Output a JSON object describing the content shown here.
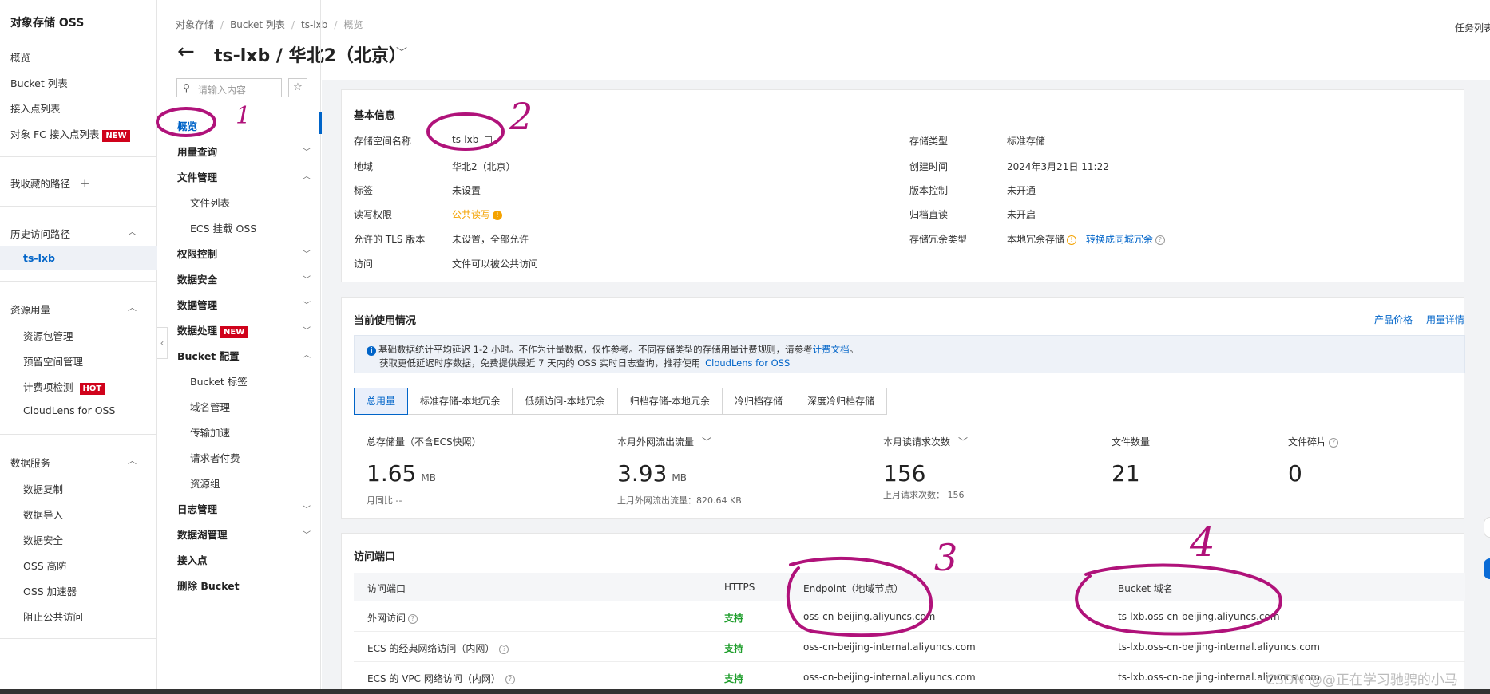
{
  "sidebar": {
    "title": "对象存储 OSS",
    "items": [
      "概览",
      "Bucket 列表",
      "接入点列表",
      "对象 FC 接入点列表"
    ],
    "fc_badge": "NEW",
    "favorites": "我收藏的路径",
    "favorites_add": "+",
    "history_group": "历史访问路径",
    "history_item": "ts-lxb",
    "resource_group": "资源用量",
    "resource_items": [
      "资源包管理",
      "预留空间管理",
      "计费项检测",
      "CloudLens for OSS"
    ],
    "hot_badge": "HOT",
    "data_group": "数据服务",
    "data_items": [
      "数据复制",
      "数据导入",
      "数据安全",
      "OSS 高防",
      "OSS 加速器",
      "阻止公共访问"
    ]
  },
  "header": {
    "breadcrumb": [
      "对象存储",
      "Bucket 列表",
      "ts-lxb",
      "概览"
    ],
    "title": "ts-lxb / 华北2（北京）",
    "task_list": "任务列表"
  },
  "subnav": {
    "search_placeholder": "请输入内容",
    "active": "概览",
    "items": {
      "usage": "用量查询",
      "file_mgmt": "文件管理",
      "file_list": "文件列表",
      "ecs_mount": "ECS 挂载 OSS",
      "perm": "权限控制",
      "data_security": "数据安全",
      "data_mgmt": "数据管理",
      "data_proc": "数据处理",
      "data_proc_badge": "NEW",
      "bucket_config": "Bucket 配置",
      "bucket_tag": "Bucket 标签",
      "domain": "域名管理",
      "transfer": "传输加速",
      "requester_pays": "请求者付费",
      "resource_group": "资源组",
      "log_mgmt": "日志管理",
      "datalake": "数据湖管理",
      "access_point": "接入点",
      "delete_bucket": "删除 Bucket"
    }
  },
  "basic_info": {
    "title": "基本信息",
    "left": [
      {
        "label": "存储空间名称",
        "value": "ts-lxb"
      },
      {
        "label": "地域",
        "value": "华北2（北京）"
      },
      {
        "label": "标签",
        "value": "未设置"
      },
      {
        "label": "读写权限",
        "value": "公共读写"
      },
      {
        "label": "允许的 TLS 版本",
        "value": "未设置，全部允许"
      },
      {
        "label": "访问",
        "value": "文件可以被公共访问"
      }
    ],
    "right": [
      {
        "label": "存储类型",
        "value": "标准存储"
      },
      {
        "label": "创建时间",
        "value": "2024年3月21日 11:22"
      },
      {
        "label": "版本控制",
        "value": "未开通"
      },
      {
        "label": "归档直读",
        "value": "未开启"
      },
      {
        "label": "存储冗余类型",
        "value": "本地冗余存储"
      }
    ],
    "convert_link": "转换成同城冗余"
  },
  "usage": {
    "title": "当前使用情况",
    "links": [
      "产品价格",
      "用量详情"
    ],
    "notice_line1_a": "基础数据统计平均延迟 1-2 小时。不作为计量数据，仅作参考。不同存储类型的存储用量计费规则，请参考",
    "notice_line1_link": "计费文档",
    "notice_line1_b": "。",
    "notice_line2_a": "获取更低延迟时序数据，免费提供最近 7 天内的 OSS 实时日志查询，推荐使用",
    "notice_line2_link": "CloudLens for OSS",
    "tabs": [
      "总用量",
      "标准存储-本地冗余",
      "低频访问-本地冗余",
      "归档存储-本地冗余",
      "冷归档存储",
      "深度冷归档存储"
    ],
    "stats": [
      {
        "label": "总存储量（不含ECS快照）",
        "value": "1.65",
        "unit": "MB",
        "sub": "月同比 --"
      },
      {
        "label": "本月外网流出流量",
        "value": "3.93",
        "unit": "MB",
        "sub": "上月外网流出流量：820.64 KB"
      },
      {
        "label": "本月读请求次数",
        "value": "156",
        "unit": "",
        "sub": "上月请求次数：  156"
      },
      {
        "label": "文件数量",
        "value": "21",
        "unit": "",
        "sub": ""
      },
      {
        "label": "文件碎片",
        "value": "0",
        "unit": "",
        "sub": ""
      }
    ]
  },
  "endpoints": {
    "title": "访问端口",
    "columns": [
      "访问端口",
      "HTTPS",
      "Endpoint（地域节点）",
      "Bucket 域名"
    ],
    "rows": [
      {
        "port": "外网访问",
        "https": "支持",
        "endpoint": "oss-cn-beijing.aliyuncs.com",
        "domain": "ts-lxb.oss-cn-beijing.aliyuncs.com"
      },
      {
        "port": "ECS 的经典网络访问（内网）",
        "https": "支持",
        "endpoint": "oss-cn-beijing-internal.aliyuncs.com",
        "domain": "ts-lxb.oss-cn-beijing-internal.aliyuncs.com"
      },
      {
        "port": "ECS 的 VPC 网络访问（内网）",
        "https": "支持",
        "endpoint": "oss-cn-beijing-internal.aliyuncs.com",
        "domain": "ts-lxb.oss-cn-beijing-internal.aliyuncs.com"
      }
    ]
  },
  "annotations": [
    "1",
    "2",
    "3",
    "4"
  ],
  "watermark": "CSDN @@正在学习驰骋的小马",
  "colors": {
    "accent": "#0064c8",
    "annotation": "#b0127a",
    "badge": "#d0021b",
    "success": "#1f9e2c",
    "warning": "#f4a200"
  }
}
